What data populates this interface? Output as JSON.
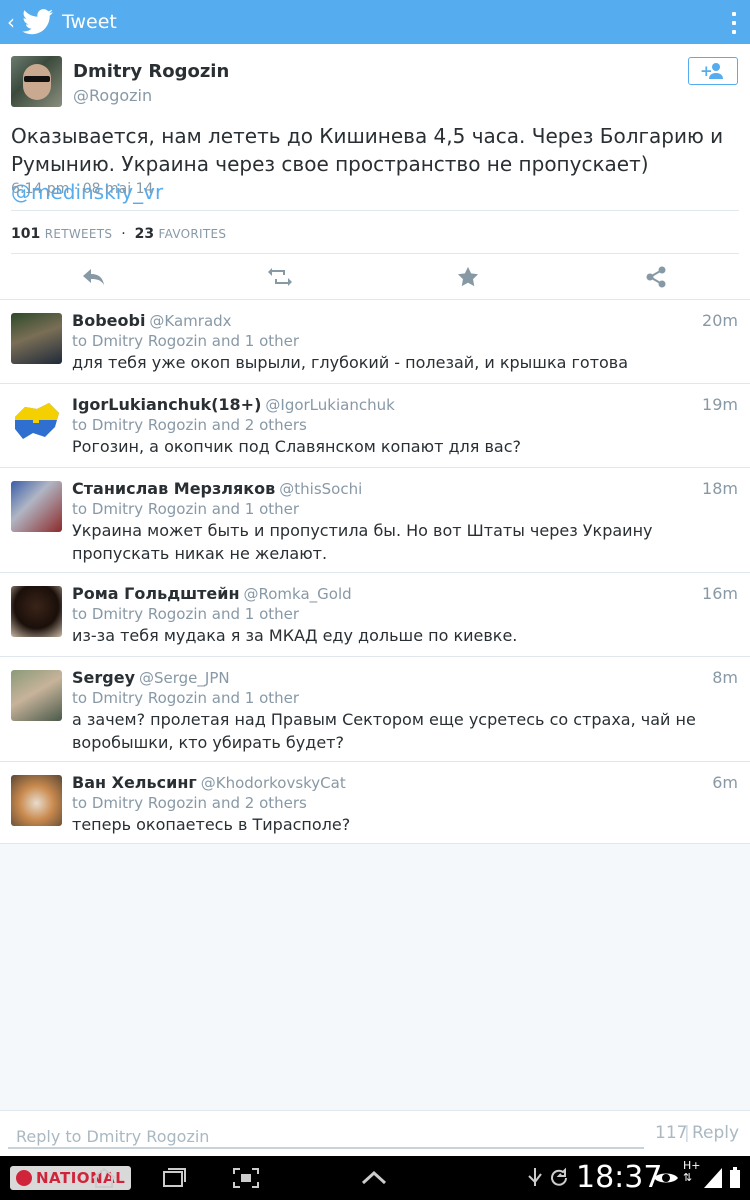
{
  "appbar": {
    "back_glyph": "‹",
    "title": "Tweet",
    "brand_color": "#55acee"
  },
  "tweet": {
    "author_name": "Dmitry Rogozin",
    "author_handle": "@Rogozin",
    "text": "Оказывается, нам лететь до Кишинева 4,5 часа. Через Болгарию и Румынию.  Украина через свое пространство не пропускает)",
    "mention": "@medinskiy_vr",
    "time": "6:14 pm · 08 mai 14",
    "retweets_count": "101",
    "retweets_label": "RETWEETS",
    "favorites_count": "23",
    "favorites_label": "FAVORITES"
  },
  "replies": [
    {
      "name": "Bobeobi",
      "handle": "@Kamradx",
      "time": "20m",
      "to": "to Dmitry Rogozin and 1 other",
      "text": "для тебя уже окоп вырыли, глубокий - полезай, и крышка готова"
    },
    {
      "name": "IgorLukianchuk(18+)",
      "handle": "@IgorLukianchuk",
      "time": "19m",
      "to": "to Dmitry Rogozin and 2 others",
      "text": "Рогозин, а окопчик под Славянском копают для вас?"
    },
    {
      "name": "Станислав Мерзляков",
      "handle": "@thisSochi",
      "time": "18m",
      "to": "to Dmitry Rogozin and 1 other",
      "text": "Украина может быть и пропустила бы. Но вот Штаты через Украину пропускать никак не желают."
    },
    {
      "name": "Рома Гольдштейн",
      "handle": "@Romka_Gold",
      "time": "16m",
      "to": "to Dmitry Rogozin and 1 other",
      "text": "из-за тебя мудака я за МКАД еду дольше по киевке."
    },
    {
      "name": "Sergey",
      "handle": "@Serge_JPN",
      "time": "8m",
      "to": "to Dmitry Rogozin and 1 other",
      "text": "а зачем? пролетая над Правым Сектором еще усретесь со страха, чай не воробышки, кто убирать будет?"
    },
    {
      "name": "Ван Хельсинг",
      "handle": "@KhodorkovskyCat",
      "time": "6m",
      "to": "to Dmitry Rogozin and 2 others",
      "text": "теперь окопаетесь в Тирасполе?"
    }
  ],
  "compose": {
    "placeholder": "Reply to Dmitry Rogozin",
    "counter": "117",
    "separator": "|",
    "reply_label": "Reply"
  },
  "system": {
    "clock": "18:37",
    "network": "H+",
    "watermark": "NATIONAL"
  }
}
